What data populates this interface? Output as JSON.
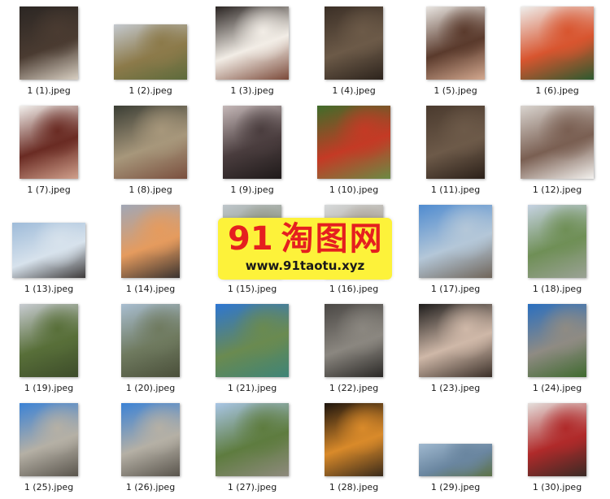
{
  "window": {
    "view": "large-icons"
  },
  "files": [
    {
      "name": "1 (1).jpeg",
      "shape": "p",
      "colors": [
        "#2b2623",
        "#4a3b31",
        "#d8cfc2"
      ]
    },
    {
      "name": "1 (2).jpeg",
      "shape": "l",
      "colors": [
        "#c4c9cf",
        "#8c7a4a",
        "#5d6b3c"
      ]
    },
    {
      "name": "1 (3).jpeg",
      "shape": "s",
      "colors": [
        "#2a2422",
        "#f2ede6",
        "#7b4a3a"
      ]
    },
    {
      "name": "1 (4).jpeg",
      "shape": "p",
      "colors": [
        "#3b2f26",
        "#6c5a48",
        "#2d241d"
      ]
    },
    {
      "name": "1 (5).jpeg",
      "shape": "p",
      "colors": [
        "#e9e6e2",
        "#5a3a2c",
        "#d3a88f"
      ]
    },
    {
      "name": "1 (6).jpeg",
      "shape": "s",
      "colors": [
        "#eeeeec",
        "#d8552f",
        "#2c5a2f"
      ]
    },
    {
      "name": "1 (7).jpeg",
      "shape": "p",
      "colors": [
        "#f2f0ed",
        "#6a2b23",
        "#d0a08c"
      ]
    },
    {
      "name": "1 (8).jpeg",
      "shape": "s",
      "colors": [
        "#3a3d34",
        "#a7977b",
        "#7a4f3e"
      ]
    },
    {
      "name": "1 (9).jpeg",
      "shape": "p",
      "colors": [
        "#c5b8b8",
        "#4a3d3e",
        "#1f1a1a"
      ]
    },
    {
      "name": "1 (10).jpeg",
      "shape": "s",
      "colors": [
        "#3f6d2a",
        "#c43a25",
        "#6b8a44"
      ]
    },
    {
      "name": "1 (11).jpeg",
      "shape": "p",
      "colors": [
        "#4a3a2e",
        "#6d5a49",
        "#2b2019"
      ]
    },
    {
      "name": "1 (12).jpeg",
      "shape": "s",
      "colors": [
        "#d9d4cf",
        "#7a5f52",
        "#f4f2ef"
      ]
    },
    {
      "name": "1 (13).jpeg",
      "shape": "l",
      "colors": [
        "#9ebbd9",
        "#d7e2ec",
        "#3d3a3a"
      ]
    },
    {
      "name": "1 (14).jpeg",
      "shape": "p",
      "colors": [
        "#a0a7b6",
        "#e59b5e",
        "#3a3330"
      ]
    },
    {
      "name": "1 (15).jpeg",
      "shape": "p",
      "colors": [
        "#bfc7cc",
        "#8a8f7a",
        "#4a4c43"
      ]
    },
    {
      "name": "1 (16).jpeg",
      "shape": "p",
      "colors": [
        "#d7dadb",
        "#a49a8c",
        "#5a554d"
      ]
    },
    {
      "name": "1 (17).jpeg",
      "shape": "s",
      "colors": [
        "#4f8bd0",
        "#b4c7d8",
        "#6f6459"
      ]
    },
    {
      "name": "1 (18).jpeg",
      "shape": "p",
      "colors": [
        "#c6d3e3",
        "#6f8f56",
        "#9aa295"
      ]
    },
    {
      "name": "1 (19).jpeg",
      "shape": "p",
      "colors": [
        "#c8ccd2",
        "#586f39",
        "#3d4c2a"
      ]
    },
    {
      "name": "1 (20).jpeg",
      "shape": "p",
      "colors": [
        "#a9bed1",
        "#6f7a5f",
        "#4a4f3a"
      ]
    },
    {
      "name": "1 (21).jpeg",
      "shape": "s",
      "colors": [
        "#2d76d3",
        "#6a8a50",
        "#3f8477"
      ]
    },
    {
      "name": "1 (22).jpeg",
      "shape": "p",
      "colors": [
        "#4a4744",
        "#8b8780",
        "#2a2826"
      ]
    },
    {
      "name": "1 (23).jpeg",
      "shape": "s",
      "colors": [
        "#1f1d1c",
        "#cfb8a8",
        "#3a2f28"
      ]
    },
    {
      "name": "1 (24).jpeg",
      "shape": "p",
      "colors": [
        "#2a6fc0",
        "#8f8b83",
        "#3f6a2f"
      ]
    },
    {
      "name": "1 (25).jpeg",
      "shape": "p",
      "colors": [
        "#3b82d6",
        "#b5b0a5",
        "#59544c"
      ]
    },
    {
      "name": "1 (26).jpeg",
      "shape": "p",
      "colors": [
        "#3b82d6",
        "#b5b0a5",
        "#59544c"
      ]
    },
    {
      "name": "1 (27).jpeg",
      "shape": "s",
      "colors": [
        "#a9c6e6",
        "#5e7c3f",
        "#8e8a7d"
      ]
    },
    {
      "name": "1 (28).jpeg",
      "shape": "p",
      "colors": [
        "#1d140d",
        "#d98a2a",
        "#3a2a1a"
      ]
    },
    {
      "name": "1 (29).jpeg",
      "shape": "w",
      "colors": [
        "#9fb8cf",
        "#6a86a0",
        "#5d7247"
      ]
    },
    {
      "name": "1 (30).jpeg",
      "shape": "p",
      "colors": [
        "#e5e0dd",
        "#b02a2a",
        "#3a2a25"
      ]
    }
  ],
  "watermark": {
    "number": "91",
    "chinese": "淘图网",
    "url": "www.91taotu.xyz"
  }
}
